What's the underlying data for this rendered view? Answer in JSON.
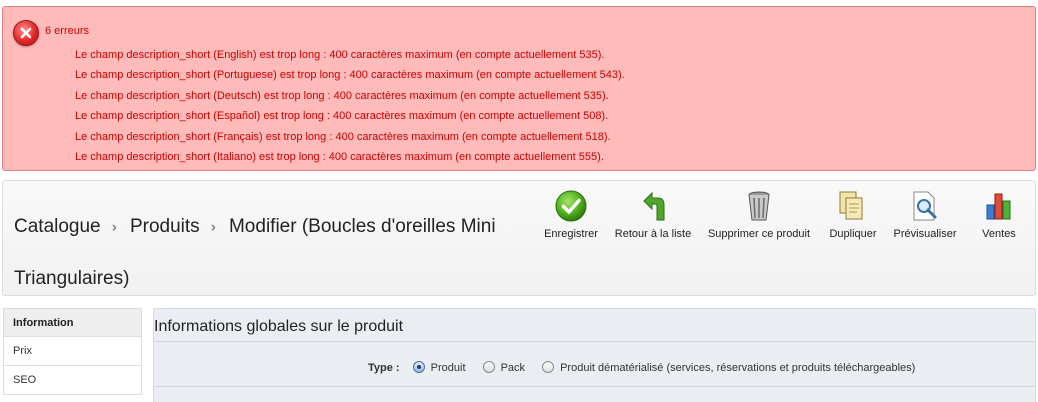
{
  "errors": {
    "title": "6 erreurs",
    "items": [
      "Le champ description_short (English) est trop long : 400 caractères maximum (en compte actuellement 535).",
      "Le champ description_short (Portuguese) est trop long : 400 caractères maximum (en compte actuellement 543).",
      "Le champ description_short (Deutsch) est trop long : 400 caractères maximum (en compte actuellement 535).",
      "Le champ description_short (Español) est trop long : 400 caractères maximum (en compte actuellement 508).",
      "Le champ description_short (Français) est trop long : 400 caractères maximum (en compte actuellement 518).",
      "Le champ description_short (Italiano) est trop long : 400 caractères maximum (en compte actuellement 555)."
    ],
    "color": "#cc0000",
    "background": "#ffbaba"
  },
  "breadcrumb": {
    "items": [
      "Catalogue",
      "Produits",
      "Modifier (Boucles d'oreilles Mini Triangulaires)"
    ]
  },
  "toolbar": {
    "save": "Enregistrer",
    "back": "Retour à la liste",
    "delete": "Supprimer ce produit",
    "duplicate": "Dupliquer",
    "preview": "Prévisualiser",
    "sales": "Ventes"
  },
  "sidebar": {
    "items": [
      "Information",
      "Prix",
      "SEO"
    ]
  },
  "main": {
    "title": "Informations globales sur le produit",
    "type_label": "Type :",
    "options": [
      "Produit",
      "Pack",
      "Produit dématérialisé (services, réservations et produits téléchargeables)"
    ],
    "selected": "Produit"
  }
}
